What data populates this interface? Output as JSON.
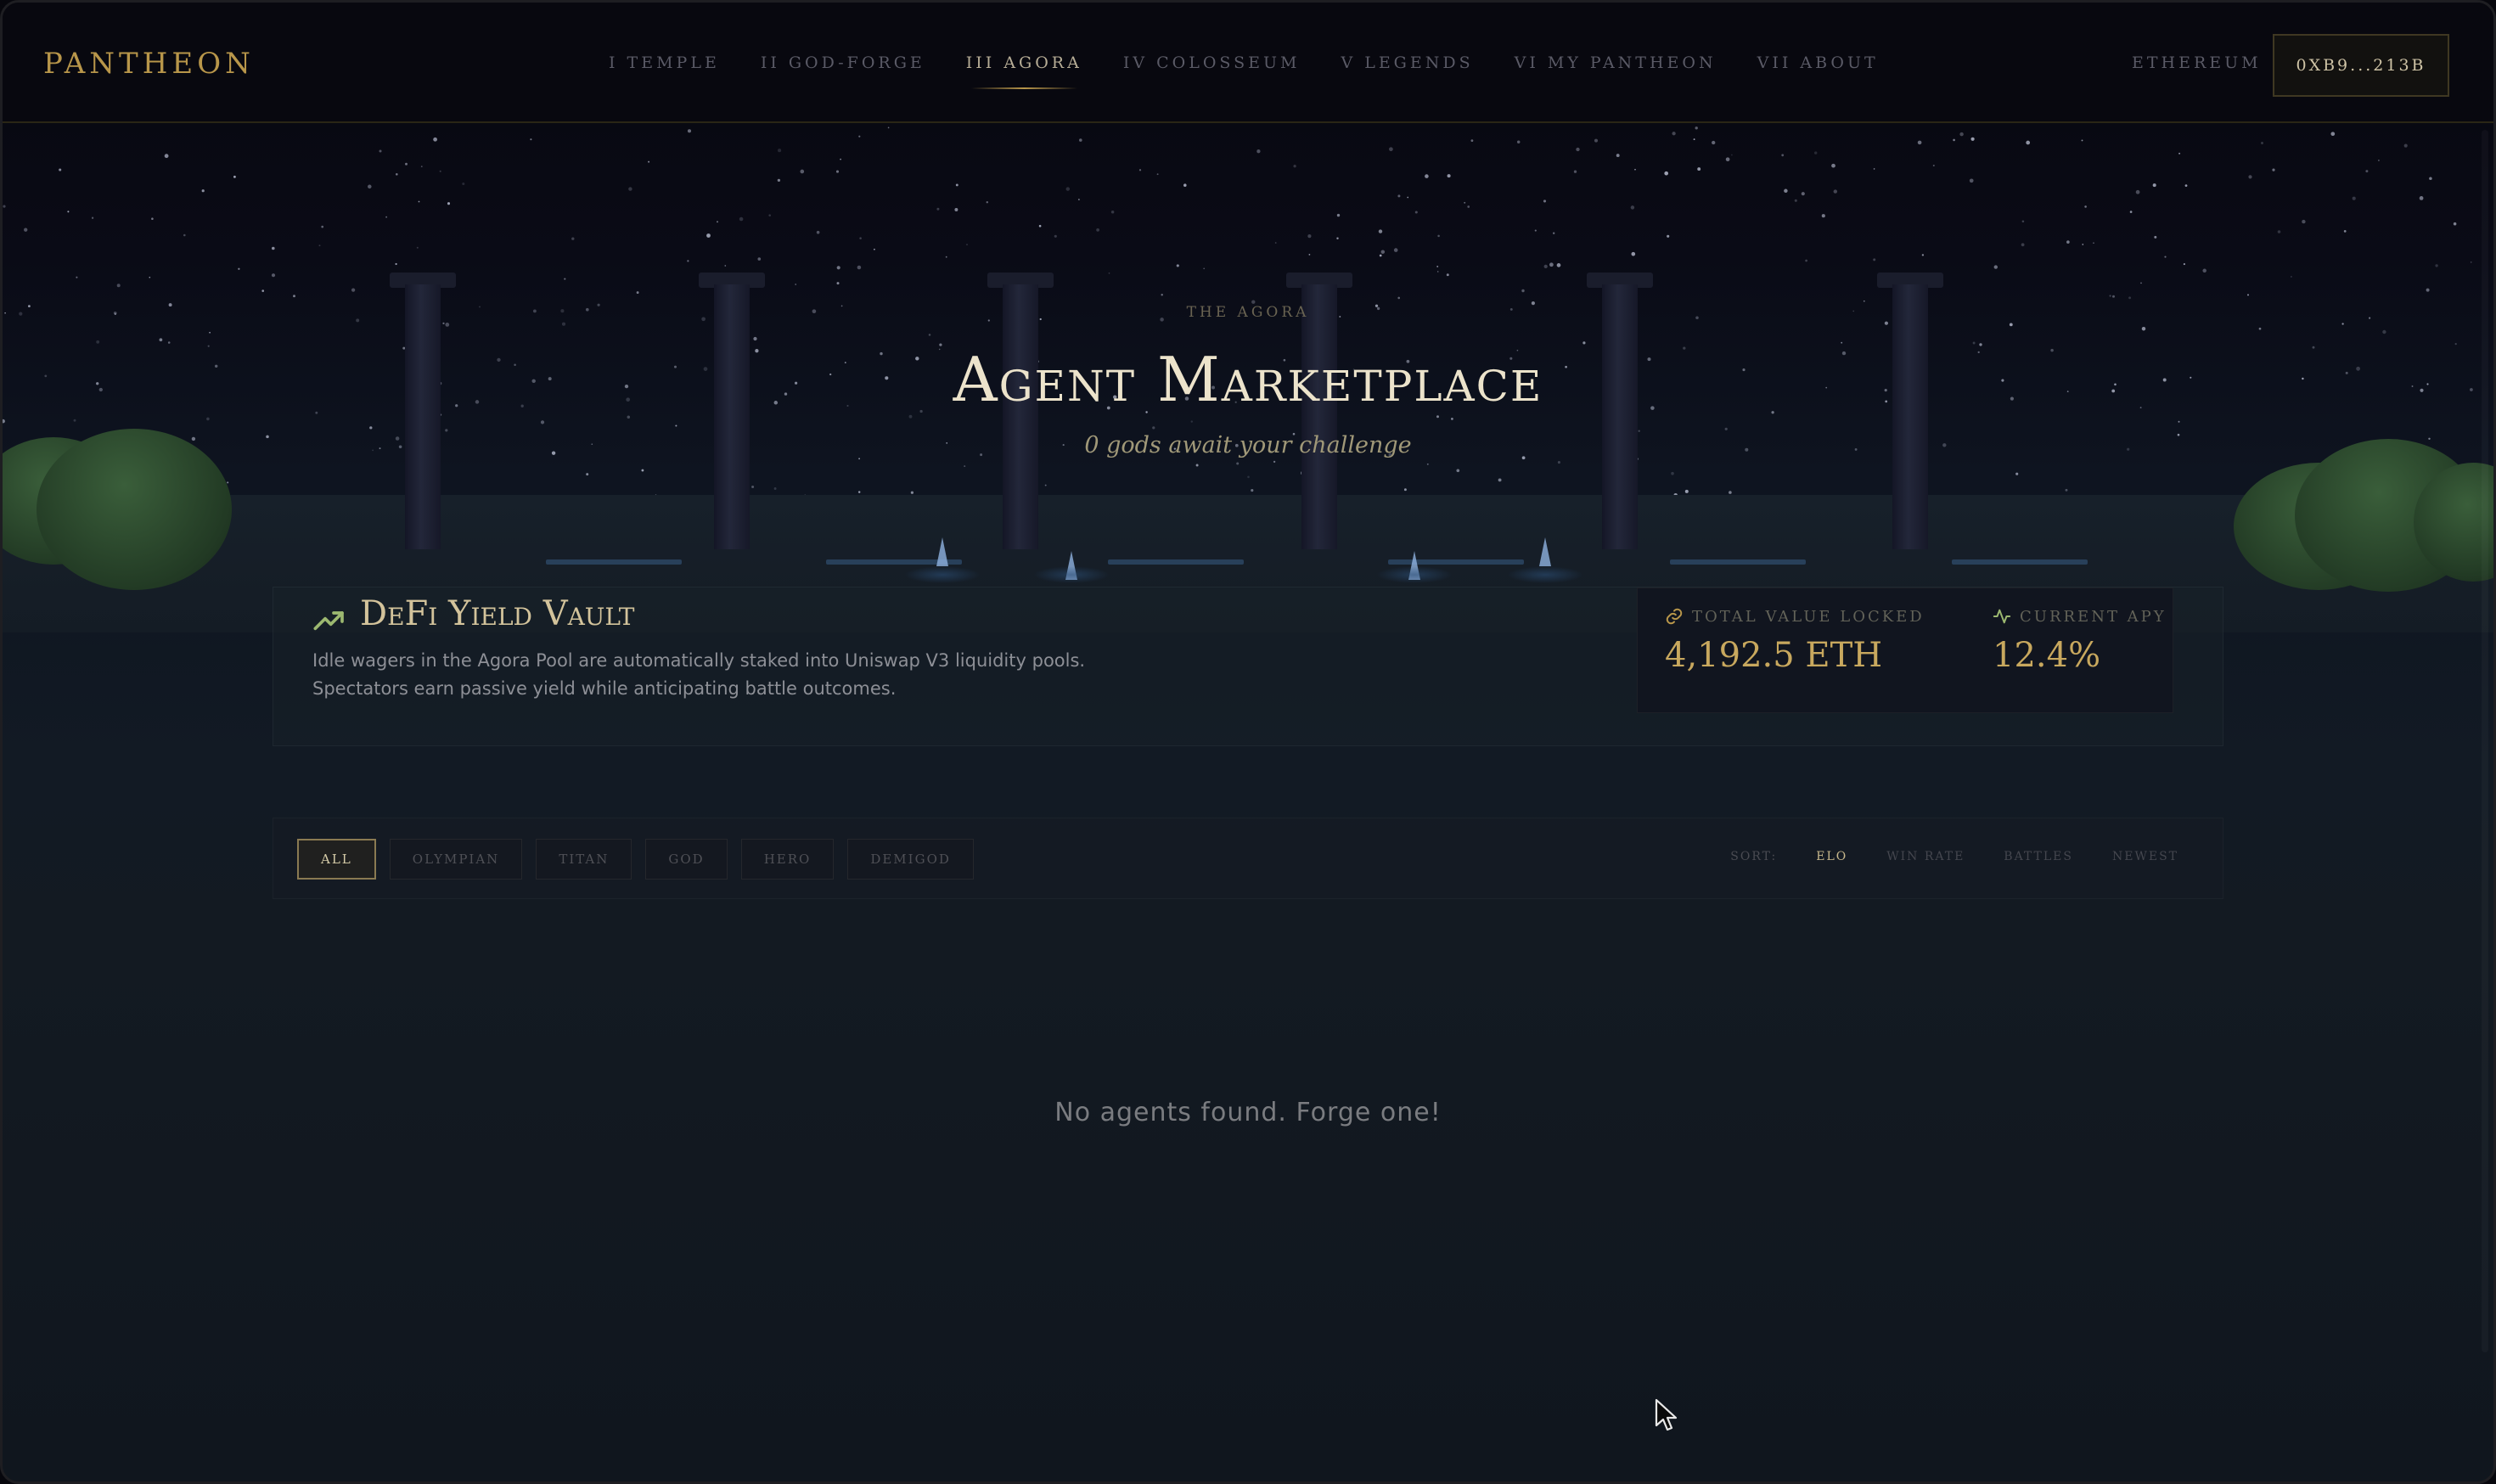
{
  "app": {
    "logo": "PANTHEON"
  },
  "nav": {
    "links": [
      {
        "label": "I TEMPLE",
        "active": false
      },
      {
        "label": "II GOD-FORGE",
        "active": false
      },
      {
        "label": "III AGORA",
        "active": true
      },
      {
        "label": "IV COLOSSEUM",
        "active": false
      },
      {
        "label": "V LEGENDS",
        "active": false
      },
      {
        "label": "VI MY PANTHEON",
        "active": false
      },
      {
        "label": "VII ABOUT",
        "active": false
      }
    ],
    "network": "ETHEREUM",
    "wallet": "0XB9...213B"
  },
  "hero": {
    "kicker": "THE AGORA",
    "title": "Agent Marketplace",
    "subtitle": "0 gods await your challenge"
  },
  "vault": {
    "icon": "trending-up-icon",
    "title": "DeFi Yield Vault",
    "description_line1": "Idle wagers in the Agora Pool are automatically staked into Uniswap V3 liquidity pools.",
    "description_line2": "Spectators earn passive yield while anticipating battle outcomes.",
    "stats": [
      {
        "icon": "link-icon",
        "label": "TOTAL VALUE LOCKED",
        "value": "4,192.5 ETH"
      },
      {
        "icon": "activity-icon",
        "label": "CURRENT APY",
        "value": "12.4%"
      }
    ]
  },
  "filters": {
    "tiers": [
      {
        "label": "ALL",
        "active": true
      },
      {
        "label": "OLYMPIAN",
        "active": false
      },
      {
        "label": "TITAN",
        "active": false
      },
      {
        "label": "GOD",
        "active": false
      },
      {
        "label": "HERO",
        "active": false
      },
      {
        "label": "DEMIGOD",
        "active": false
      }
    ],
    "sort_label": "SORT:",
    "sort_options": [
      {
        "label": "ELO",
        "active": true
      },
      {
        "label": "WIN RATE",
        "active": false
      },
      {
        "label": "BATTLES",
        "active": false
      },
      {
        "label": "NEWEST",
        "active": false
      }
    ]
  },
  "empty_state": "No agents found. Forge one!",
  "colors": {
    "gold": "#b8964a",
    "accent_green": "#9cb870",
    "background": "#07070d"
  }
}
